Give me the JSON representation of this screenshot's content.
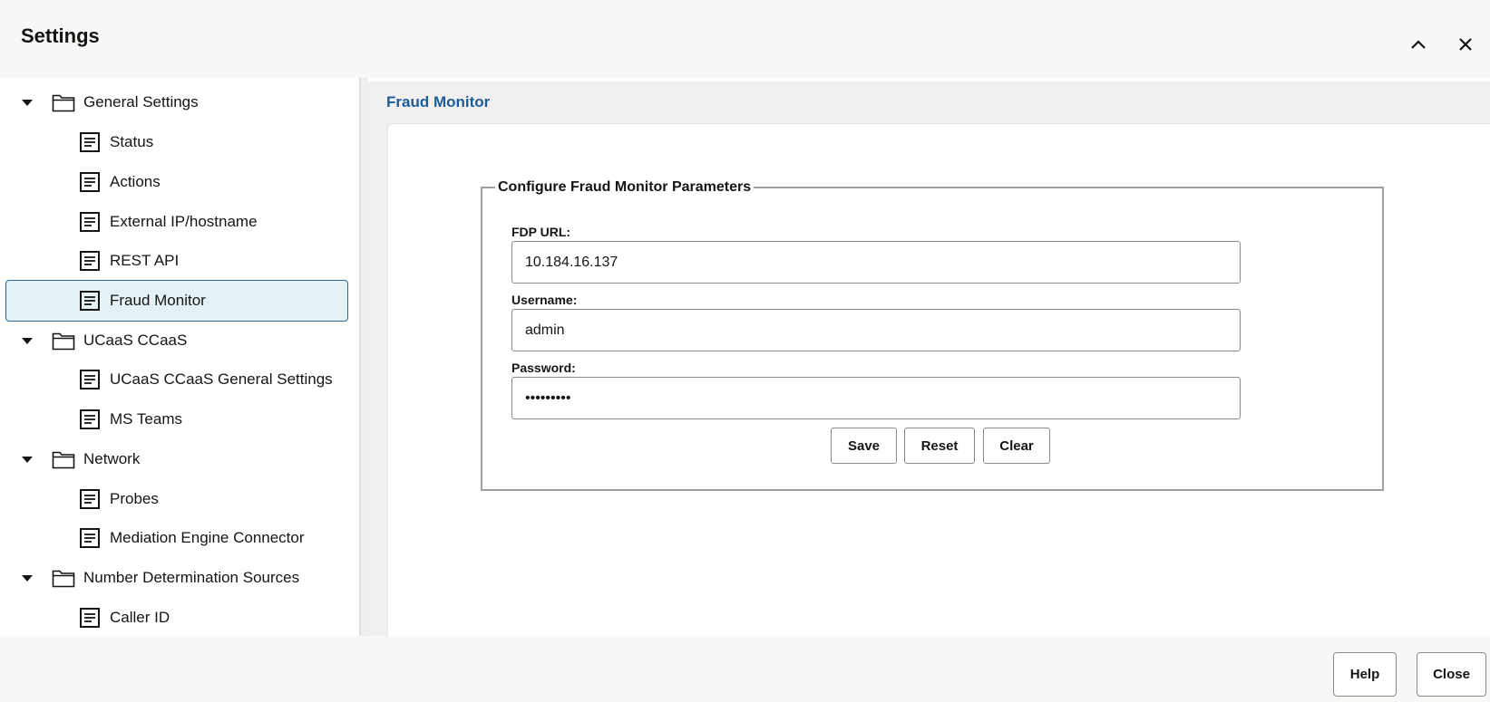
{
  "dialog": {
    "title": "Settings",
    "collapse_icon": "chevron-up-icon",
    "close_icon": "close-icon"
  },
  "tree": {
    "folders": [
      {
        "label": "General Settings",
        "expanded": true
      },
      {
        "label": "UCaaS CCaaS",
        "expanded": true
      },
      {
        "label": "Network",
        "expanded": true
      },
      {
        "label": "Number Determination Sources",
        "expanded": true
      }
    ],
    "items": [
      {
        "label": "Status"
      },
      {
        "label": "Actions"
      },
      {
        "label": "External IP/hostname"
      },
      {
        "label": "REST API"
      },
      {
        "label": "Fraud Monitor",
        "selected": true
      },
      {
        "label": "UCaaS CCaaS General Settings"
      },
      {
        "label": "MS Teams"
      },
      {
        "label": "Probes"
      },
      {
        "label": "Mediation Engine Connector"
      },
      {
        "label": "Caller ID"
      }
    ]
  },
  "content": {
    "title": "Fraud Monitor",
    "group_legend": "Configure Fraud Monitor Parameters",
    "fields": {
      "fdp_url": {
        "label": "FDP URL:",
        "value": "10.184.16.137"
      },
      "username": {
        "label": "Username:",
        "value": "admin"
      },
      "password": {
        "label": "Password:",
        "value": "secretpw1"
      }
    },
    "buttons": {
      "save": "Save",
      "reset": "Reset",
      "clear": "Clear"
    }
  },
  "footer": {
    "help": "Help",
    "close": "Close"
  },
  "colors": {
    "accent_title": "#1c5d99",
    "selected_bg": "#e4f1f7",
    "selected_border": "#2d6c8c"
  }
}
